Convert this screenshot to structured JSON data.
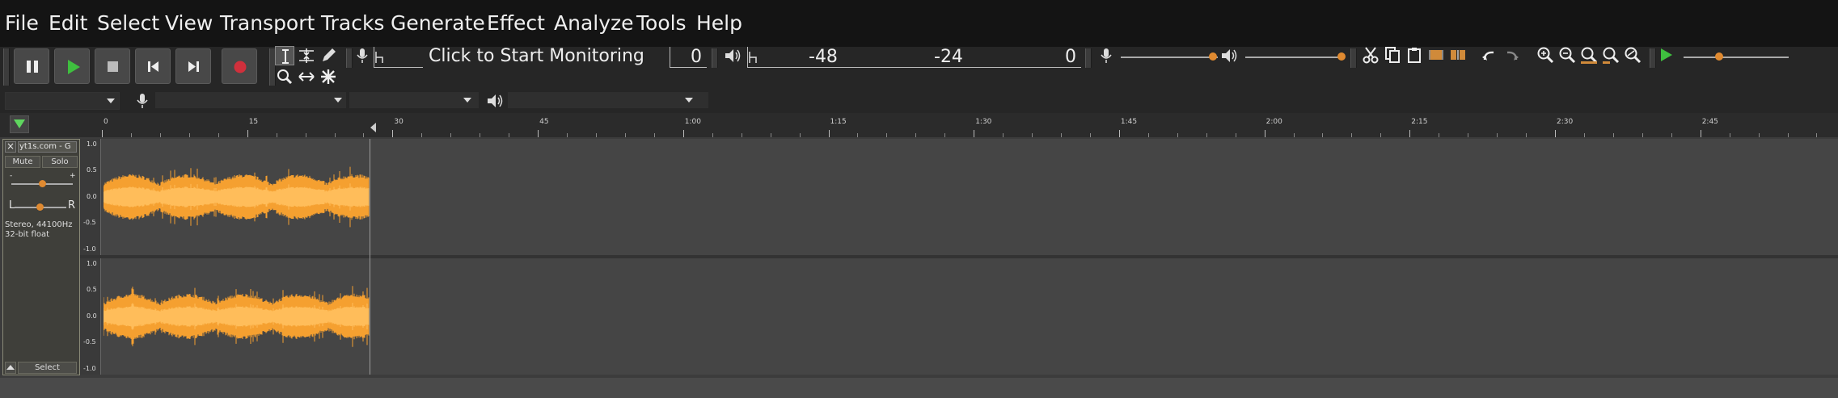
{
  "menu": [
    "File",
    "Edit",
    "Select",
    "View",
    "Transport",
    "Tracks",
    "Generate",
    "Effect",
    "Analyze",
    "Tools",
    "Help"
  ],
  "meter": {
    "monitor_text": "Click to Start Monitoring",
    "record_zero": "0",
    "play_ticks": [
      "-48",
      "-24",
      "0"
    ]
  },
  "ruler": {
    "labels": [
      "0",
      "15",
      "30",
      "45",
      "1:00",
      "1:15",
      "1:30",
      "1:45",
      "2:00",
      "2:15",
      "2:30",
      "2:45"
    ]
  },
  "track": {
    "name": "yt1s.com - G",
    "mute_label": "Mute",
    "solo_label": "Solo",
    "pan_left": "L",
    "pan_right": "R",
    "gain_minus": "-",
    "gain_plus": "+",
    "info_line1": "Stereo, 44100Hz",
    "info_line2": "32-bit float",
    "select_label": "Select",
    "scale": [
      "1.0",
      "0.5",
      "0.0",
      "-0.5",
      "-1.0"
    ]
  },
  "colors": {
    "waveform": "#f5a030",
    "waveform_light": "#ffbd5a",
    "record": "#d0303c",
    "play": "#3fbf3f"
  },
  "icons": [
    "pause-icon",
    "play-icon",
    "stop-icon",
    "skip-start-icon",
    "skip-end-icon",
    "record-icon",
    "selection-tool-icon",
    "envelope-tool-icon",
    "draw-tool-icon",
    "zoom-tool-icon",
    "timeshift-tool-icon",
    "multi-tool-icon",
    "microphone-icon",
    "speaker-icon",
    "cut-icon",
    "copy-icon",
    "paste-icon",
    "trim-icon",
    "silence-icon",
    "undo-icon",
    "redo-icon",
    "zoom-in-icon",
    "zoom-out-icon",
    "fit-selection-icon",
    "fit-project-icon",
    "zoom-toggle-icon"
  ]
}
